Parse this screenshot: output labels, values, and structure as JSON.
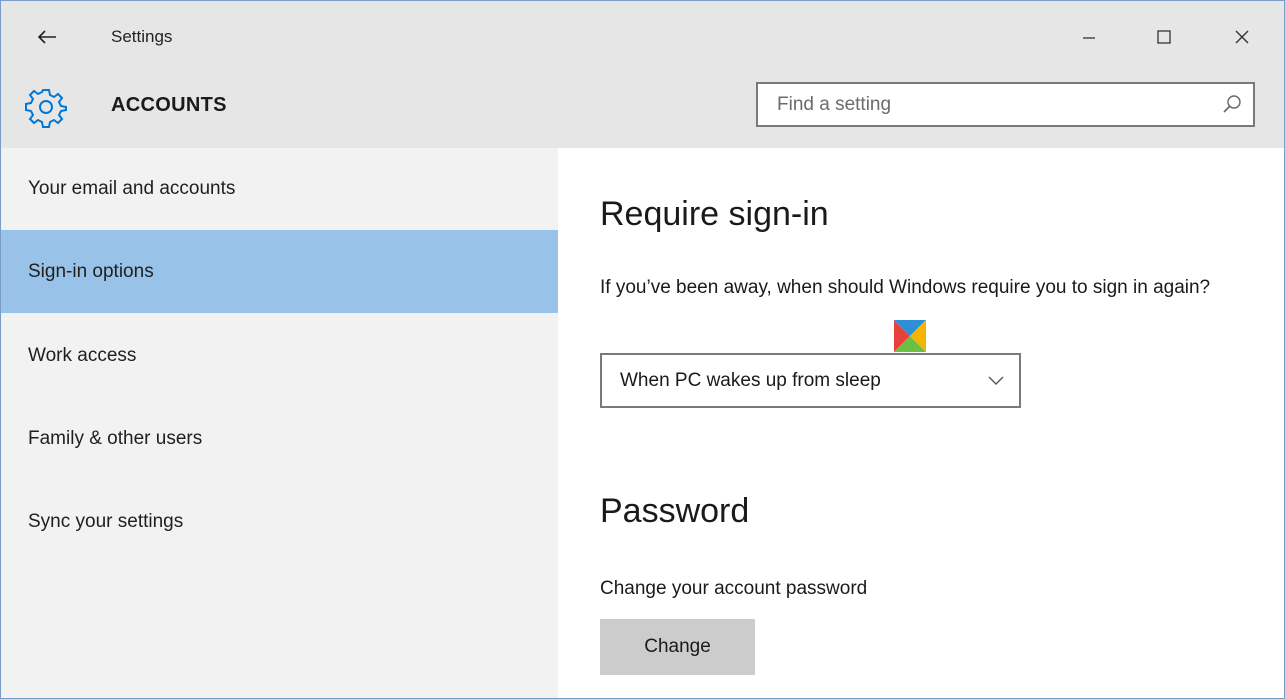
{
  "window": {
    "app_title": "Settings",
    "back_icon": "back-arrow-icon",
    "controls": [
      "minimize-icon",
      "maximize-icon",
      "close-icon"
    ]
  },
  "header": {
    "icon": "gear-icon",
    "title": "ACCOUNTS",
    "search_placeholder": "Find a setting",
    "search_value": ""
  },
  "sidebar": {
    "items": [
      {
        "label": "Your email and accounts",
        "selected": false
      },
      {
        "label": "Sign-in options",
        "selected": true
      },
      {
        "label": "Work access",
        "selected": false
      },
      {
        "label": "Family & other users",
        "selected": false
      },
      {
        "label": "Sync your settings",
        "selected": false
      }
    ]
  },
  "main": {
    "require_heading": "Require sign-in",
    "require_question": "If you’ve been away, when should Windows require you to sign in again?",
    "require_selected": "When PC wakes up from sleep",
    "password_heading": "Password",
    "password_desc": "Change your account password",
    "change_button": "Change"
  },
  "colors": {
    "accent": "#0078d7",
    "selected_nav": "#99c2e8",
    "header_bg": "#e6e6e6",
    "sidebar_bg": "#f2f2f2",
    "button_bg": "#cccccc"
  }
}
